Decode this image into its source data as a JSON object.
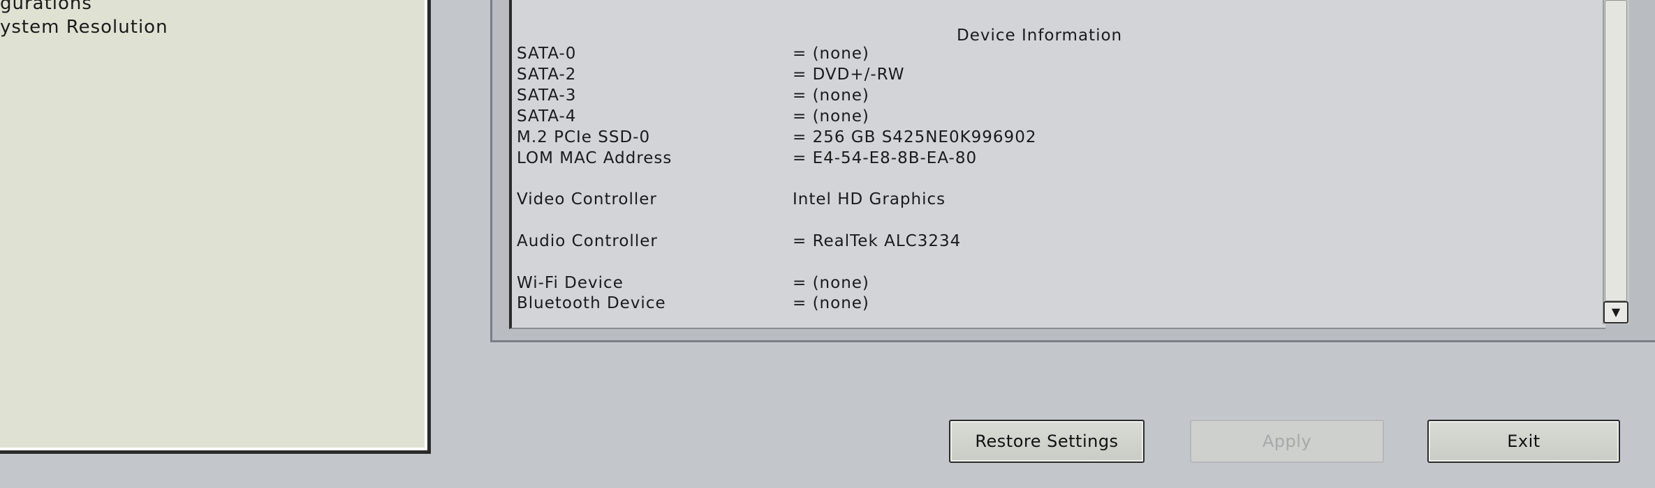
{
  "left_panel": {
    "items": [
      "gurations",
      "ystem Resolution"
    ]
  },
  "device_information": {
    "title": "Device Information",
    "rows": [
      {
        "label": "SATA-0",
        "value": "= (none)"
      },
      {
        "label": "SATA-2",
        "value": "= DVD+/-RW"
      },
      {
        "label": "SATA-3",
        "value": "= (none)"
      },
      {
        "label": "SATA-4",
        "value": "= (none)"
      },
      {
        "label": "M.2 PCIe SSD-0",
        "value": "= 256 GB S425NE0K996902"
      },
      {
        "label": "LOM MAC Address",
        "value": "= E4-54-E8-8B-EA-80"
      },
      {
        "label": "Video Controller",
        "value": "Intel HD Graphics"
      },
      {
        "label": "Audio Controller",
        "value": "= RealTek ALC3234"
      },
      {
        "label": "Wi-Fi Device",
        "value": "= (none)"
      },
      {
        "label": "Bluetooth Device",
        "value": "= (none)"
      }
    ]
  },
  "scrollbar": {
    "down_arrow_icon": "▼"
  },
  "buttons": {
    "restore": "Restore Settings",
    "apply": "Apply",
    "exit": "Exit"
  }
}
